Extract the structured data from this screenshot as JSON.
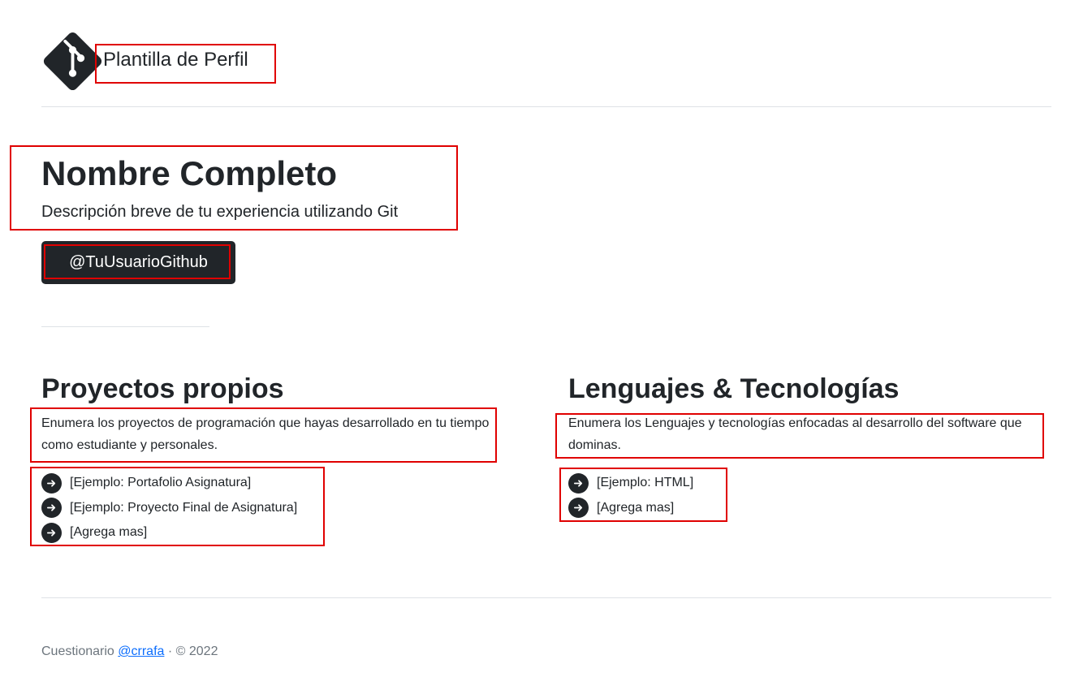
{
  "header": {
    "site_title": "Plantilla de Perfil",
    "logo_icon": "git-logo-icon"
  },
  "profile": {
    "name": "Nombre Completo",
    "description": "Descripción breve de tu experiencia utilizando Git",
    "github_button": "@TuUsuarioGithub"
  },
  "projects": {
    "title": "Proyectos propios",
    "description": "Enumera los proyectos de programación que hayas desarrollado en tu tiempo como estudiante y personales.",
    "items": [
      "[Ejemplo: Portafolio Asignatura]",
      "[Ejemplo: Proyecto Final de Asignatura]",
      "[Agrega mas]"
    ]
  },
  "languages": {
    "title": "Lenguajes & Tecnologías",
    "description": "Enumera los Lenguajes y tecnologías enfocadas al desarrollo del software que dominas.",
    "items": [
      "[Ejemplo: HTML]",
      "[Agrega mas]"
    ]
  },
  "footer": {
    "prefix": "Cuestionario",
    "link": "@crrafa",
    "suffix": "· © 2022"
  },
  "colors": {
    "dark": "#212529",
    "highlight": "#e00000",
    "link": "#0d6efd",
    "muted": "#6c757d"
  }
}
